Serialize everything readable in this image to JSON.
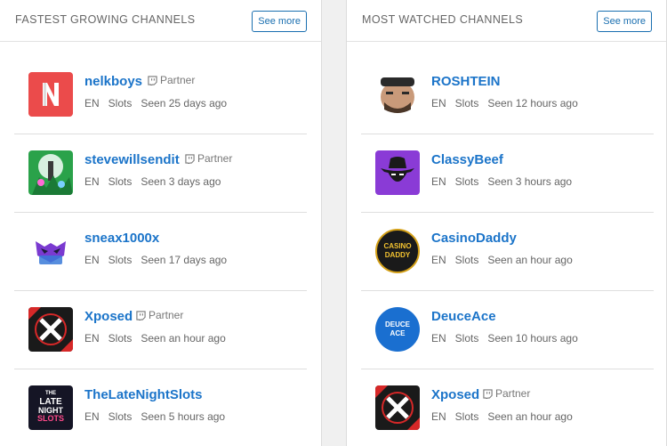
{
  "left": {
    "title": "FASTEST GROWING CHANNELS",
    "see_more": "See more",
    "items": [
      {
        "name": "nelkboys",
        "partner": "Partner",
        "lang": "EN",
        "category": "Slots",
        "seen": "Seen 25 days ago"
      },
      {
        "name": "stevewillsendit",
        "partner": "Partner",
        "lang": "EN",
        "category": "Slots",
        "seen": "Seen 3 days ago"
      },
      {
        "name": "sneax1000x",
        "lang": "EN",
        "category": "Slots",
        "seen": "Seen 17 days ago"
      },
      {
        "name": "Xposed",
        "partner": "Partner",
        "lang": "EN",
        "category": "Slots",
        "seen": "Seen an hour ago"
      },
      {
        "name": "TheLateNightSlots",
        "lang": "EN",
        "category": "Slots",
        "seen": "Seen 5 hours ago",
        "avatar_text": [
          "THE",
          "LATE",
          "NIGHT",
          "SLOTS"
        ]
      }
    ]
  },
  "right": {
    "title": "MOST WATCHED CHANNELS",
    "see_more": "See more",
    "items": [
      {
        "name": "ROSHTEIN",
        "lang": "EN",
        "category": "Slots",
        "seen": "Seen 12 hours ago"
      },
      {
        "name": "ClassyBeef",
        "lang": "EN",
        "category": "Slots",
        "seen": "Seen 3 hours ago"
      },
      {
        "name": "CasinoDaddy",
        "lang": "EN",
        "category": "Slots",
        "seen": "Seen an hour ago",
        "avatar_text": [
          "CASINO",
          "DADDY"
        ]
      },
      {
        "name": "DeuceAce",
        "lang": "EN",
        "category": "Slots",
        "seen": "Seen 10 hours ago",
        "avatar_text": [
          "DEUCE",
          "ACE"
        ]
      },
      {
        "name": "Xposed",
        "partner": "Partner",
        "lang": "EN",
        "category": "Slots",
        "seen": "Seen an hour ago"
      }
    ]
  },
  "colors": {
    "link": "#1b74c9",
    "border": "#1a6fb0",
    "text_muted": "#666666"
  }
}
